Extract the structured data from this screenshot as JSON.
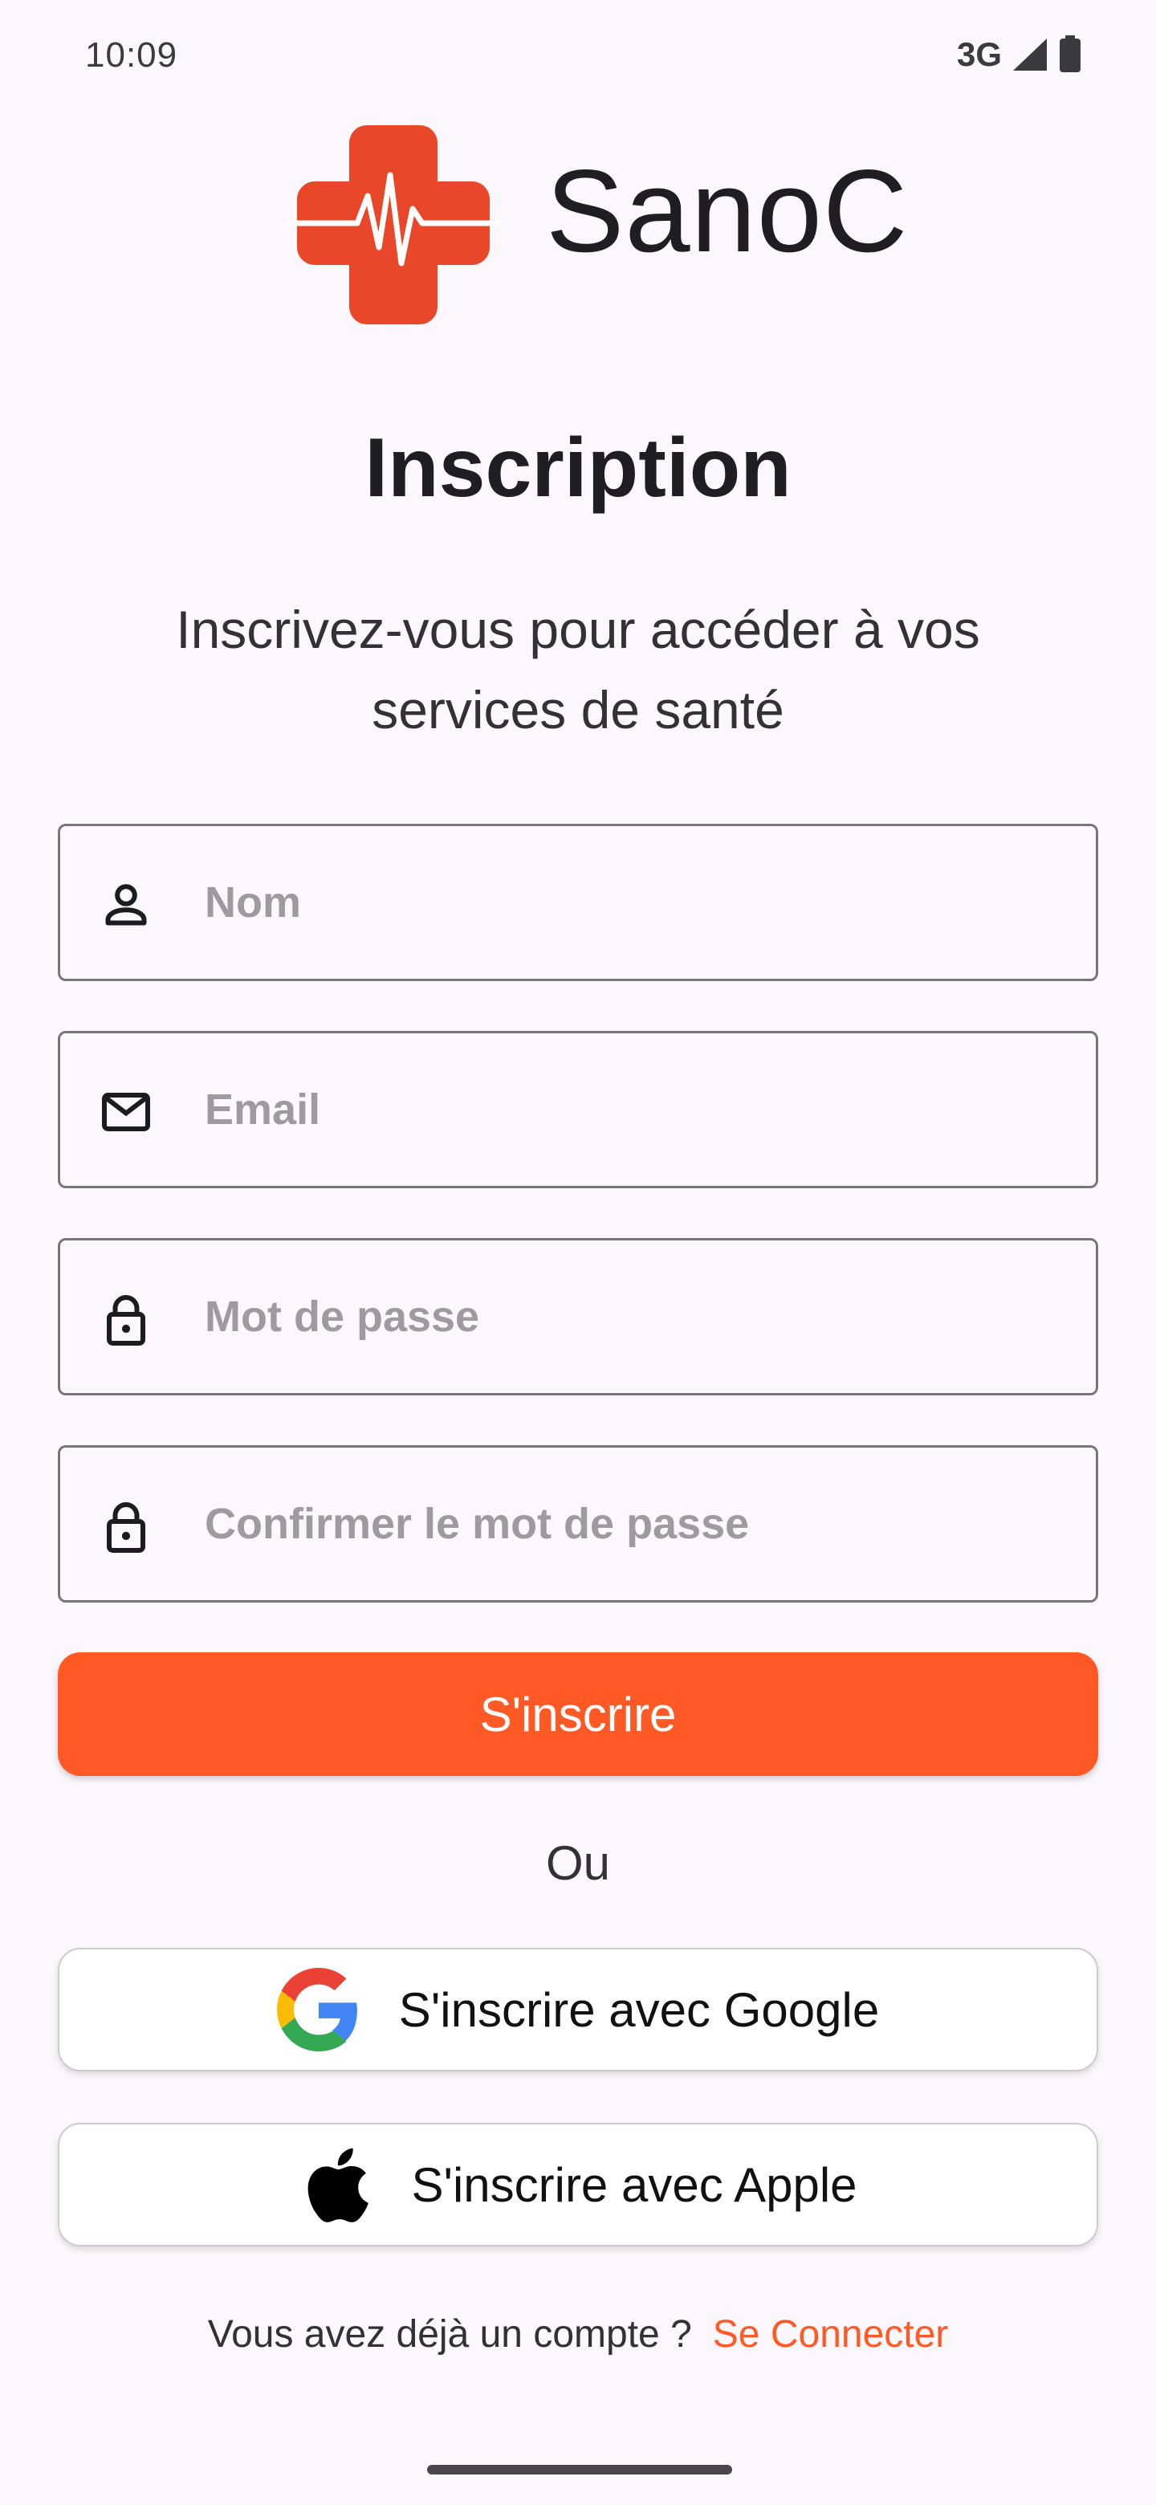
{
  "status_bar": {
    "time": "10:09",
    "network": "3G"
  },
  "brand": {
    "name": "SanoC",
    "accent": "#e9472a"
  },
  "page": {
    "title": "Inscription",
    "subtitle": "Inscrivez-vous pour accéder à vos services de santé"
  },
  "form": {
    "name_placeholder": "Nom",
    "email_placeholder": "Email",
    "password_placeholder": "Mot de passe",
    "confirm_placeholder": "Confirmer le mot de passe",
    "submit_label": "S'inscrire"
  },
  "divider_text": "Ou",
  "social": {
    "google_label": "S'inscrire avec Google",
    "apple_label": "S'inscrire avec Apple"
  },
  "footer": {
    "prompt": "Vous avez déjà un compte ?",
    "link": "Se Connecter"
  },
  "colors": {
    "primary": "#ff5a26",
    "background": "#fcf7fc"
  },
  "icons": {
    "name_field": "person-icon",
    "email_field": "mail-icon",
    "password_field": "lock-icon",
    "confirm_field": "lock-icon",
    "google": "google-icon",
    "apple": "apple-icon"
  }
}
